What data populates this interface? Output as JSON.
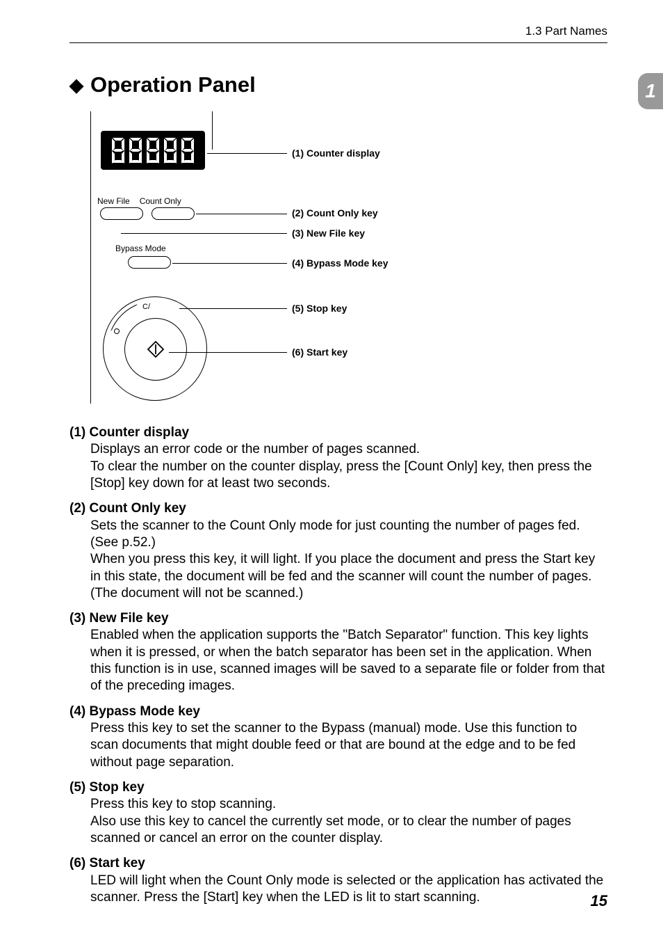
{
  "header": {
    "section": "1.3  Part Names"
  },
  "chapter_tab": "1",
  "title": "Operation Panel",
  "diagram": {
    "labels": {
      "new_file": "New File",
      "count_only": "Count Only",
      "bypass_mode": "Bypass Mode",
      "stop": "C/"
    },
    "callouts": {
      "c1": "(1) Counter display",
      "c2": "(2) Count Only key",
      "c3": "(3) New File key",
      "c4": "(4) Bypass Mode key",
      "c5": "(5) Stop key",
      "c6": "(6) Start key"
    }
  },
  "desc": {
    "i1": {
      "title": "(1) Counter display",
      "body": "Displays an error code or the number of pages scanned.\nTo clear the number on the counter display, press the [Count Only] key, then press the [Stop] key down for at least two seconds."
    },
    "i2": {
      "title": "(2) Count Only key",
      "body": "Sets the scanner to the Count Only mode for just counting the number of pages fed. (See p.52.)\nWhen you press this key, it will light. If you place the document and press the Start key in this state, the document will be fed and the scanner will count the number of pages. (The document will not be scanned.)"
    },
    "i3": {
      "title": "(3) New File key",
      "body": "Enabled when the application supports the \"Batch Separator\" function. This key lights when it is pressed, or when the batch separator has been set in the application. When this function is in use, scanned images will be saved to a separate file or folder from that of the preceding images."
    },
    "i4": {
      "title": "(4) Bypass Mode key",
      "body": "Press this key to set the scanner to the Bypass (manual) mode. Use this function to scan documents that might double feed or that are bound at the edge and to be fed without page separation."
    },
    "i5": {
      "title": "(5) Stop key",
      "body": "Press this key to stop scanning.\nAlso use this key to cancel the currently set mode, or to clear the number of pages scanned or cancel an error on the counter display."
    },
    "i6": {
      "title": "(6) Start key",
      "body": "LED will light when the Count Only mode is selected or the application has activated the scanner. Press the [Start] key when the LED is lit to start scanning."
    }
  },
  "page_number": "15"
}
